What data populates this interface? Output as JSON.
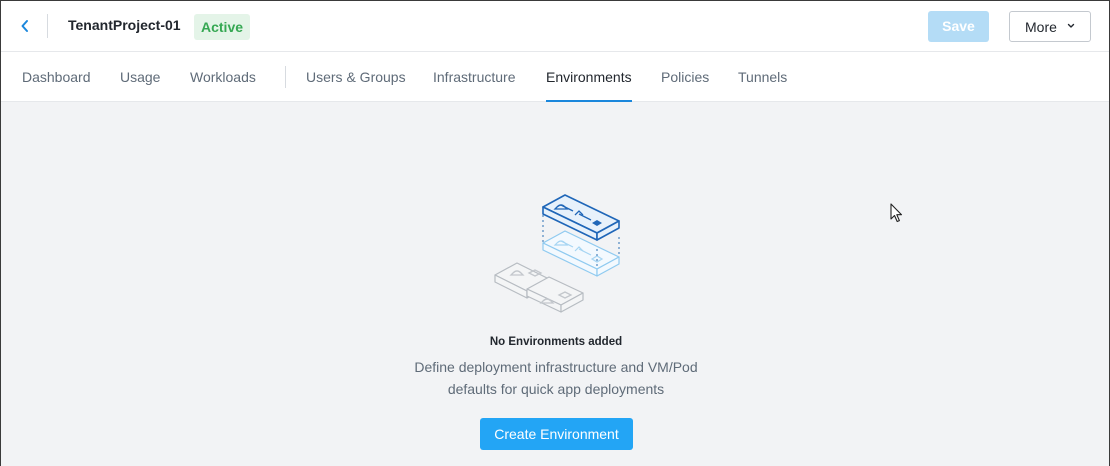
{
  "header": {
    "project_name": "TenantProject-01",
    "status": "Active",
    "save_label": "Save",
    "more_label": "More"
  },
  "tabs": [
    {
      "label": "Dashboard"
    },
    {
      "label": "Usage"
    },
    {
      "label": "Workloads"
    },
    {
      "label": "Users & Groups"
    },
    {
      "label": "Infrastructure"
    },
    {
      "label": "Environments"
    },
    {
      "label": "Policies"
    },
    {
      "label": "Tunnels"
    }
  ],
  "active_tab": "Environments",
  "empty_state": {
    "title": "No Environments added",
    "description_line1": "Define deployment infrastructure and VM/Pod",
    "description_line2": "defaults for quick app deployments",
    "button_label": "Create Environment",
    "illustration": "stacked-environments-illustration"
  },
  "colors": {
    "accent": "#23a5f5",
    "tab_underline": "#1b87dc",
    "status_green": "#36a853",
    "save_disabled": "#b4dcf6"
  },
  "icons": {
    "back": "chevron-left-icon",
    "more": "chevron-down-icon",
    "cursor": "mouse-pointer-icon"
  }
}
